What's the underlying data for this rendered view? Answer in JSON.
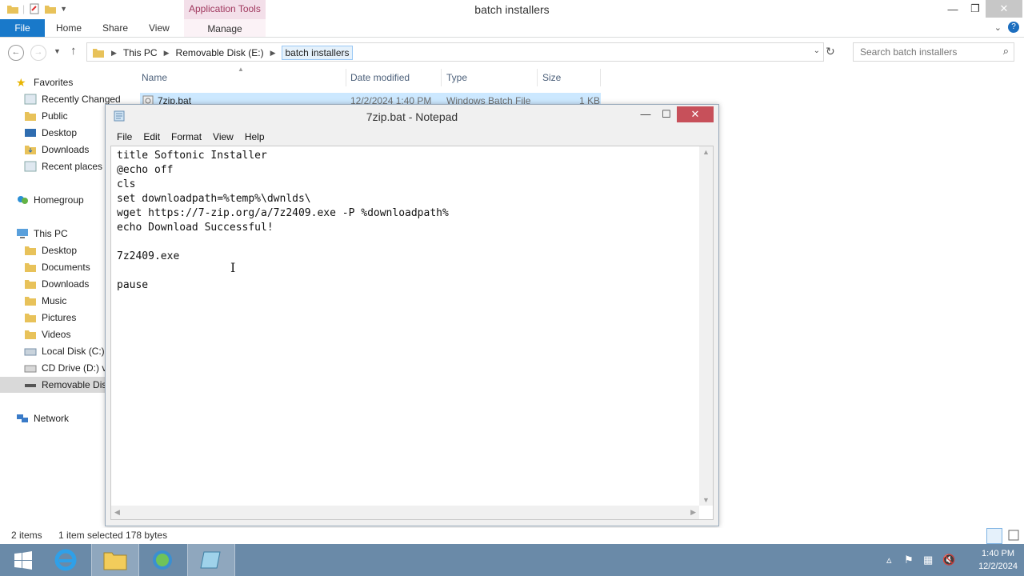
{
  "explorer": {
    "window_title": "batch installers",
    "contextual_tab_group": "Application Tools",
    "ribbon_tabs": {
      "file": "File",
      "home": "Home",
      "share": "Share",
      "view": "View",
      "manage": "Manage"
    },
    "breadcrumbs": [
      "This PC",
      "Removable Disk (E:)",
      "batch installers"
    ],
    "search_placeholder": "Search batch installers",
    "nav": {
      "favorites": "Favorites",
      "recently_changed": "Recently Changed",
      "public": "Public",
      "desktop": "Desktop",
      "downloads": "Downloads",
      "recent_places": "Recent places",
      "homegroup": "Homegroup",
      "this_pc": "This PC",
      "pc_desktop": "Desktop",
      "documents": "Documents",
      "pc_downloads": "Downloads",
      "music": "Music",
      "pictures": "Pictures",
      "videos": "Videos",
      "local_disk": "Local Disk (C:)",
      "cd_drive": "CD Drive (D:) vi",
      "removable_disk": "Removable Dis",
      "network": "Network"
    },
    "columns": {
      "name": "Name",
      "date_modified": "Date modified",
      "type": "Type",
      "size": "Size"
    },
    "file_row": {
      "name": "7zip.bat",
      "date": "12/2/2024 1:40 PM",
      "type": "Windows Batch File",
      "size": "1 KB"
    },
    "status": {
      "items": "2 items",
      "selected": "1 item selected  178 bytes"
    }
  },
  "notepad": {
    "title": "7zip.bat - Notepad",
    "menu": [
      "File",
      "Edit",
      "Format",
      "View",
      "Help"
    ],
    "content": "title Softonic Installer\n@echo off\ncls\nset downloadpath=%temp%\\dwnlds\\\nwget https://7-zip.org/a/7z2409.exe -P %downloadpath%\necho Download Successful!\n\n7z2409.exe\n\npause"
  },
  "taskbar": {
    "clock_time": "1:40 PM",
    "clock_date": "12/2/2024",
    "icons": [
      "start-icon",
      "internet-explorer-icon",
      "file-explorer-icon",
      "network-globe-icon",
      "notepad-icon"
    ]
  },
  "colors": {
    "accent": "#1979ca",
    "taskbar": "#6a8aa8",
    "selection": "#cce8ff",
    "contextual_tab": "#a0385e"
  }
}
